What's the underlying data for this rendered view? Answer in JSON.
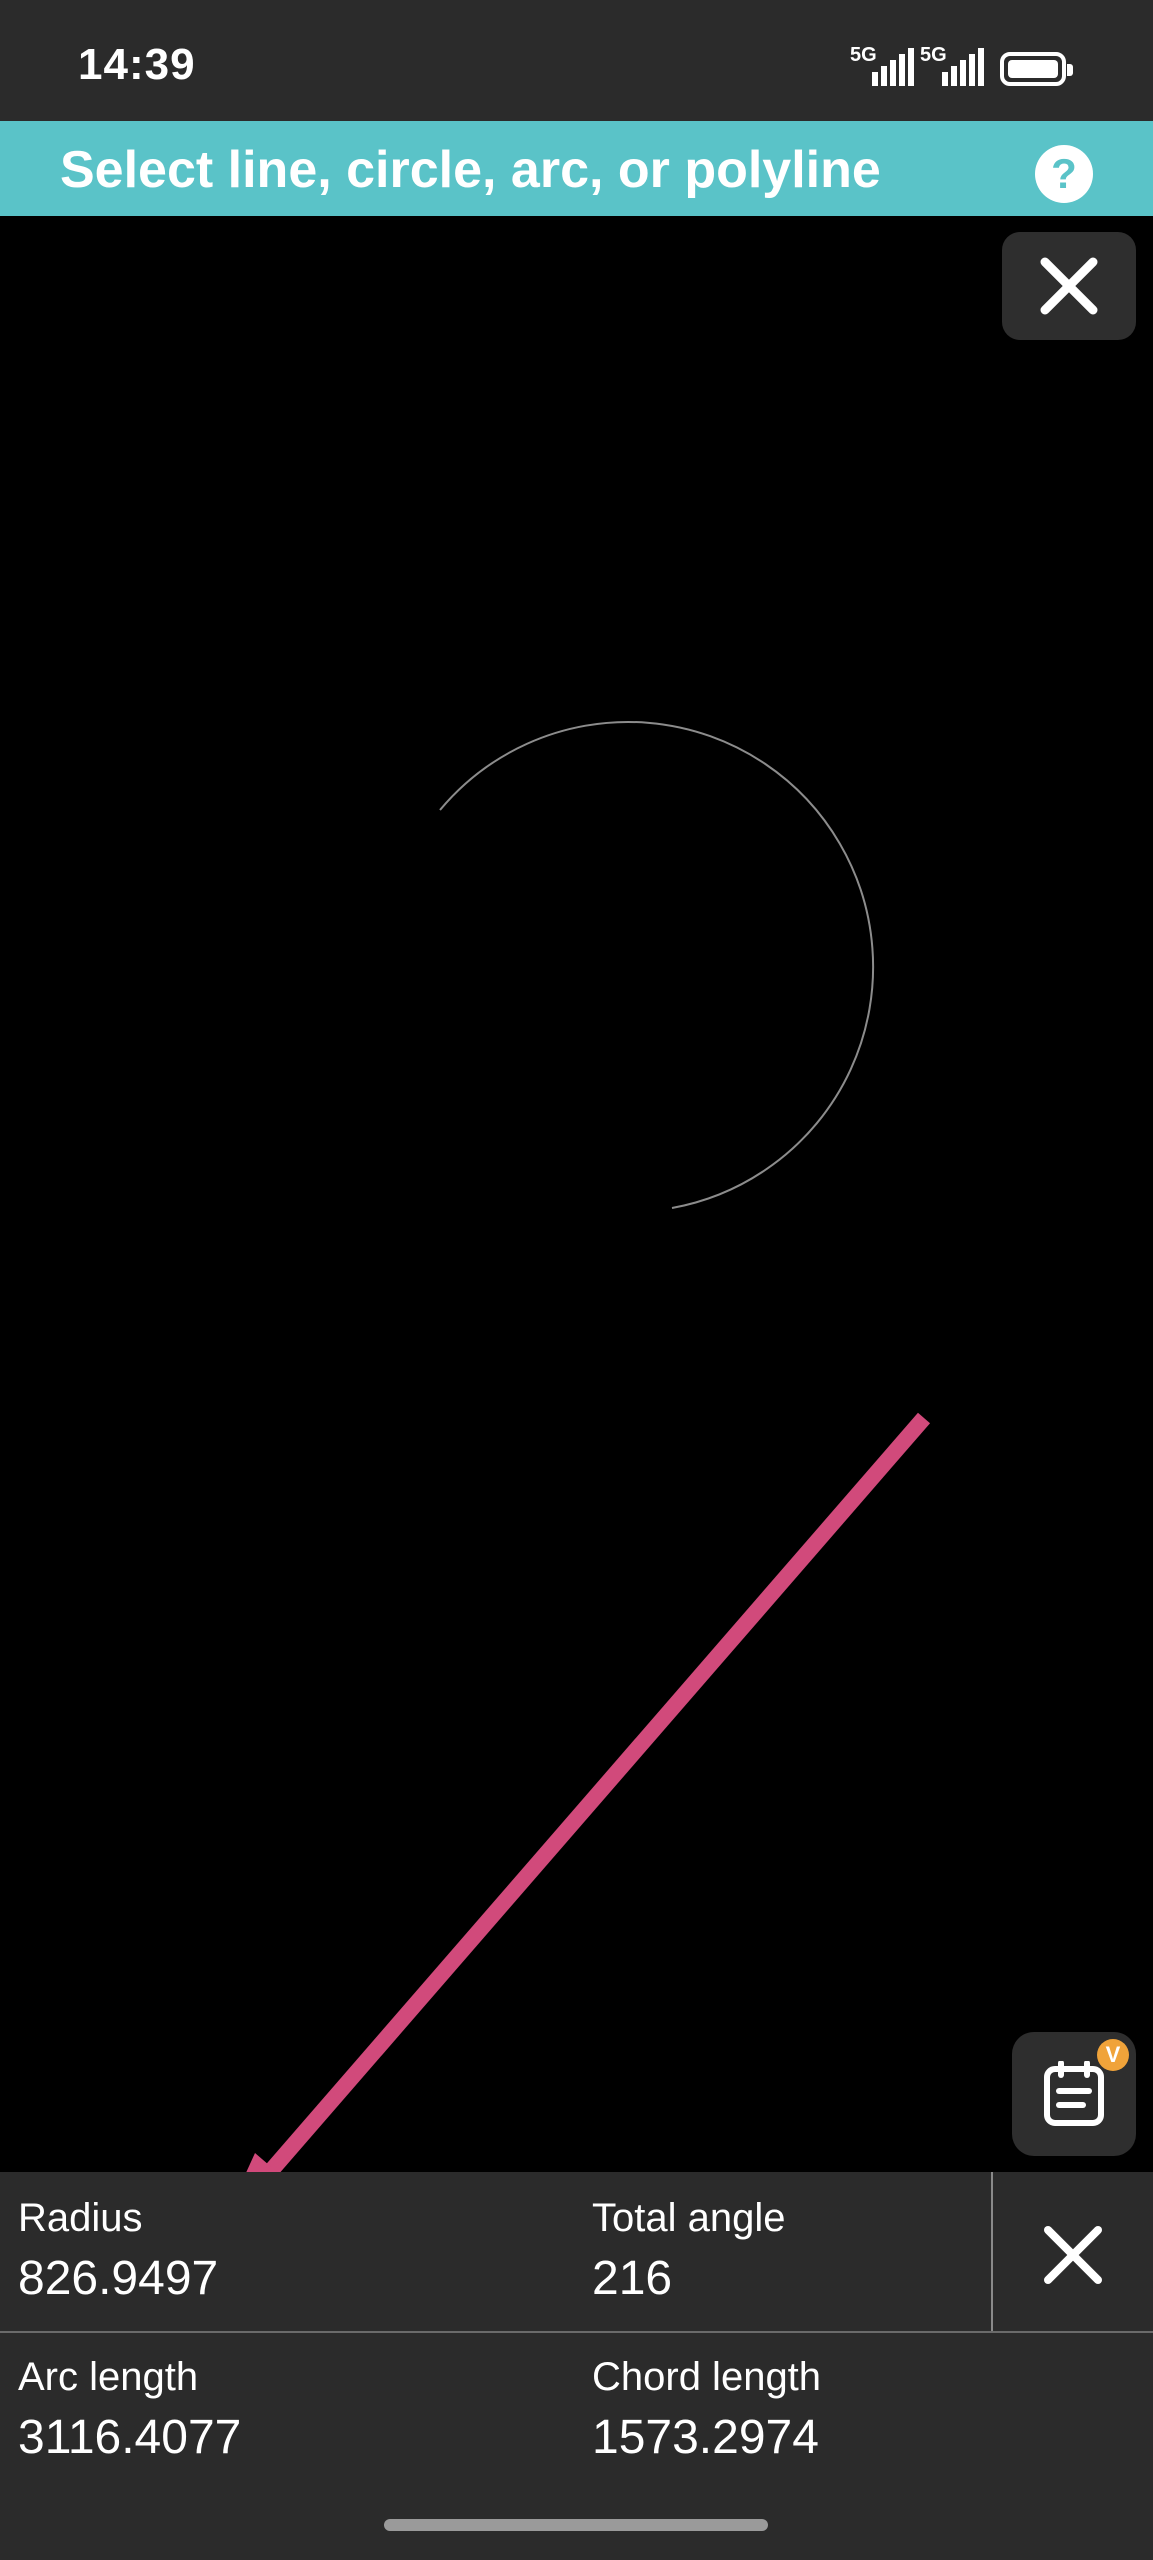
{
  "status_bar": {
    "time": "14:39",
    "network_1": "5G",
    "network_2": "5G",
    "icons": [
      "signal-icon",
      "signal-icon",
      "battery-icon"
    ]
  },
  "header": {
    "title": "Select line, circle, arc, or polyline",
    "help_label": "?"
  },
  "top_close": {
    "icon": "close-icon"
  },
  "fab": {
    "icon": "notes-icon",
    "badge": "V"
  },
  "measurements": {
    "radius_label": "Radius",
    "radius_value": "826.9497",
    "total_angle_label": "Total angle",
    "total_angle_value": "216",
    "arc_length_label": "Arc length",
    "arc_length_value": "3116.4077",
    "chord_length_label": "Chord length",
    "chord_length_value": "1573.2974"
  },
  "colors": {
    "header_bg": "#5ac3c8",
    "arrow": "#d14a7b",
    "panel_bg": "#2b2b2b",
    "badge": "#f0a33a"
  }
}
